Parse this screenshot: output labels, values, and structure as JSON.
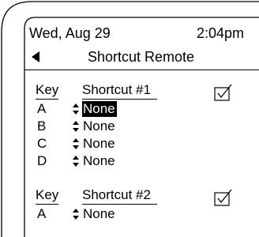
{
  "status": {
    "date": "Wed, Aug 29",
    "time": "2:04pm"
  },
  "screen": {
    "title": "Shortcut Remote",
    "back_icon": "left-triangle-icon"
  },
  "groups": [
    {
      "key_header": "Key",
      "shortcut_header": "Shortcut #1",
      "enabled": true,
      "rows": [
        {
          "key": "A",
          "value": "None",
          "selected": true
        },
        {
          "key": "B",
          "value": "None",
          "selected": false
        },
        {
          "key": "C",
          "value": "None",
          "selected": false
        },
        {
          "key": "D",
          "value": "None",
          "selected": false
        }
      ]
    },
    {
      "key_header": "Key",
      "shortcut_header": "Shortcut #2",
      "enabled": true,
      "rows": [
        {
          "key": "A",
          "value": "None",
          "selected": false
        }
      ]
    }
  ]
}
